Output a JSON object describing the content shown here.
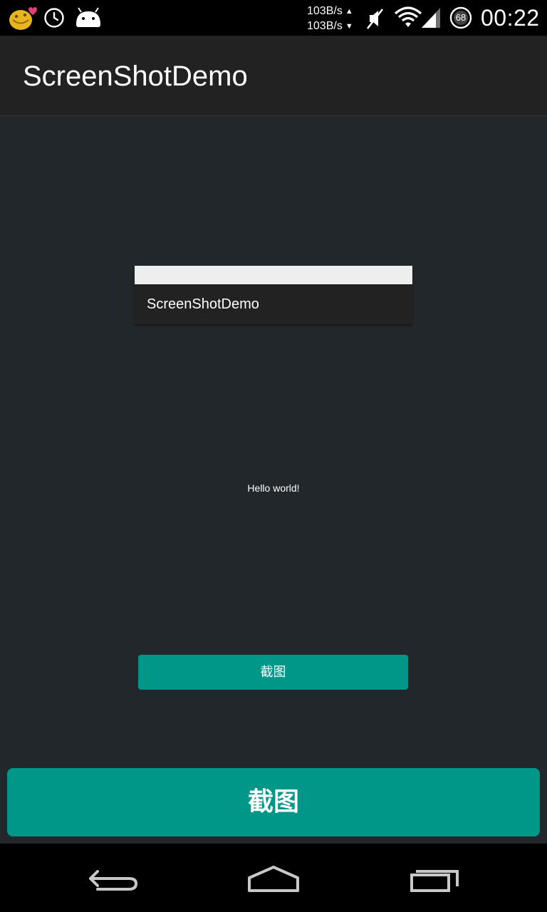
{
  "status_bar": {
    "speed_up": "103B/s",
    "speed_down": "103B/s",
    "battery_level": "68",
    "time": "00:22",
    "icons": [
      "emoji-notification-icon",
      "alarm-clock-icon",
      "android-debug-icon",
      "network-speed-up-icon",
      "network-speed-down-icon",
      "mute-icon",
      "wifi-icon",
      "signal-icon",
      "battery-circle-icon"
    ]
  },
  "action_bar": {
    "title": "ScreenShotDemo"
  },
  "preview": {
    "title": "ScreenShotDemo"
  },
  "content": {
    "hello_text": "Hello world!"
  },
  "buttons": {
    "screenshot_small_label": "截图",
    "screenshot_large_label": "截图"
  },
  "nav_bar": {
    "icons": [
      "back-icon",
      "home-icon",
      "recents-icon"
    ]
  },
  "colors": {
    "accent": "#009688",
    "background": "#21272b",
    "action_bar": "#222222",
    "status_bar": "#000000"
  }
}
